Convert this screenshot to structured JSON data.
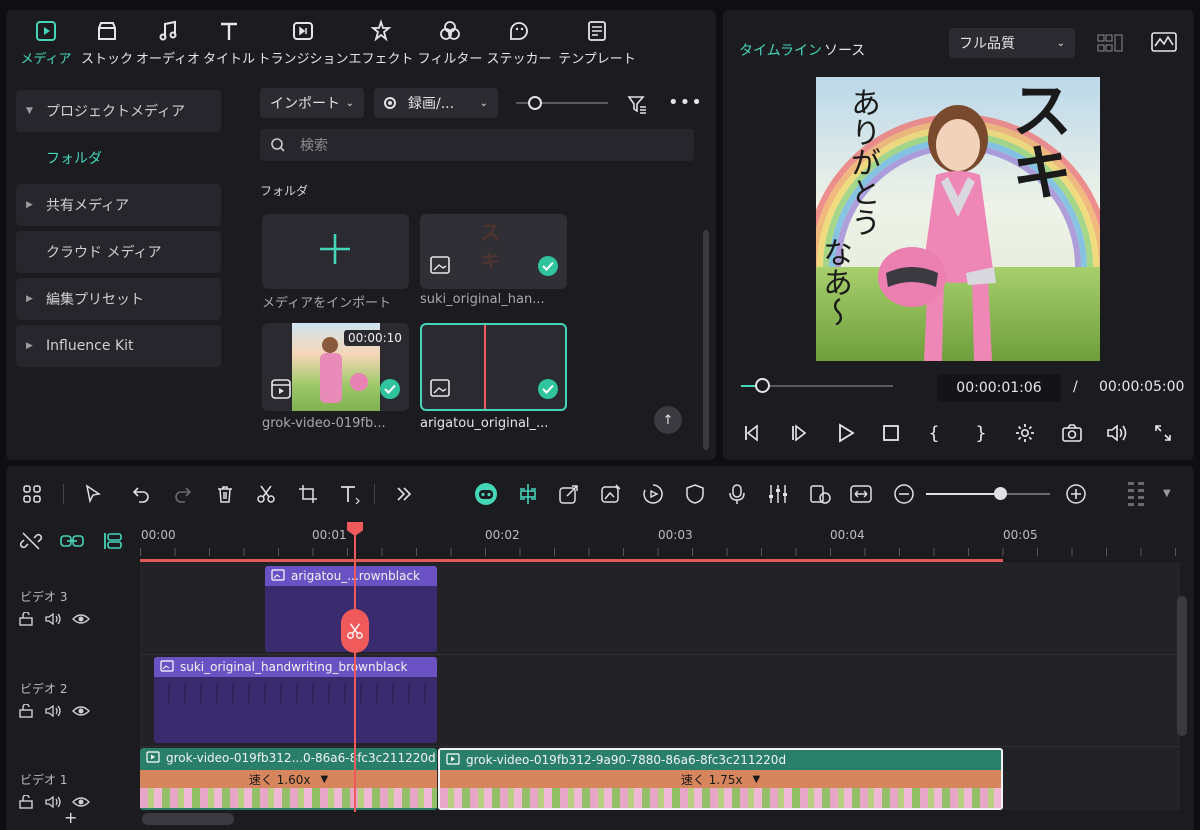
{
  "media_tabs": [
    {
      "label": "メディア",
      "icon": "media-icon",
      "active": true
    },
    {
      "label": "ストック",
      "icon": "stock-icon"
    },
    {
      "label": "オーディオ",
      "icon": "audio-icon"
    },
    {
      "label": "タイトル",
      "icon": "title-icon"
    },
    {
      "label": "トランジション",
      "icon": "transition-icon"
    },
    {
      "label": "エフェクト",
      "icon": "effect-icon"
    },
    {
      "label": "フィルター",
      "icon": "filter-icon"
    },
    {
      "label": "ステッカー",
      "icon": "sticker-icon"
    },
    {
      "label": "テンプレート",
      "icon": "template-icon"
    }
  ],
  "sidebar": {
    "items": [
      {
        "label": "プロジェクトメディア"
      },
      {
        "label": "フォルダ"
      },
      {
        "label": "共有メディア"
      },
      {
        "label": "クラウド メディア"
      },
      {
        "label": "編集プリセット"
      },
      {
        "label": "Influence Kit"
      }
    ]
  },
  "media": {
    "import_label": "インポート",
    "record_label": "録画/...",
    "search_placeholder": "検索",
    "folder_heading": "フォルダ",
    "items": [
      {
        "label": "メディアをインポート"
      },
      {
        "label": "suki_original_han..."
      },
      {
        "label": "grok-video-019fb...",
        "duration": "00:00:10"
      },
      {
        "label": "arigatou_original_..."
      }
    ]
  },
  "player": {
    "tab_timeline": "タイムライン",
    "tab_source": "ソース",
    "quality": "フル品質",
    "current_time": "00:00:01:06",
    "separator": "/",
    "total_time": "00:00:05:00",
    "progress": 0.14,
    "preview_text": {
      "big": "スキ",
      "vertical": [
        "ありがとう",
        "なあ〜"
      ]
    }
  },
  "timeline": {
    "ruler": [
      "00:00",
      "00:01",
      "00:02",
      "00:03",
      "00:04",
      "00:05"
    ],
    "tracks": [
      {
        "label": "ビデオ 3"
      },
      {
        "label": "ビデオ 2"
      },
      {
        "label": "ビデオ 1"
      }
    ],
    "clips": {
      "v3": "arigatou_...rownblack",
      "v2": "suki_original_handwriting_brownblack",
      "v1a": "grok-video-019fb312...0-86a6-8fc3c211220d",
      "v1a_speed": "速く 1.60x",
      "v1b": "grok-video-019fb312-9a90-7880-86a6-8fc3c211220d",
      "v1b_speed": "速く 1.75x"
    },
    "zoom_level": 0.6
  },
  "colors": {
    "accent": "#45d6b8",
    "playhead": "#f05a5a",
    "clip_purple": "#5b3fa8",
    "clip_green": "#2a7f6a"
  }
}
